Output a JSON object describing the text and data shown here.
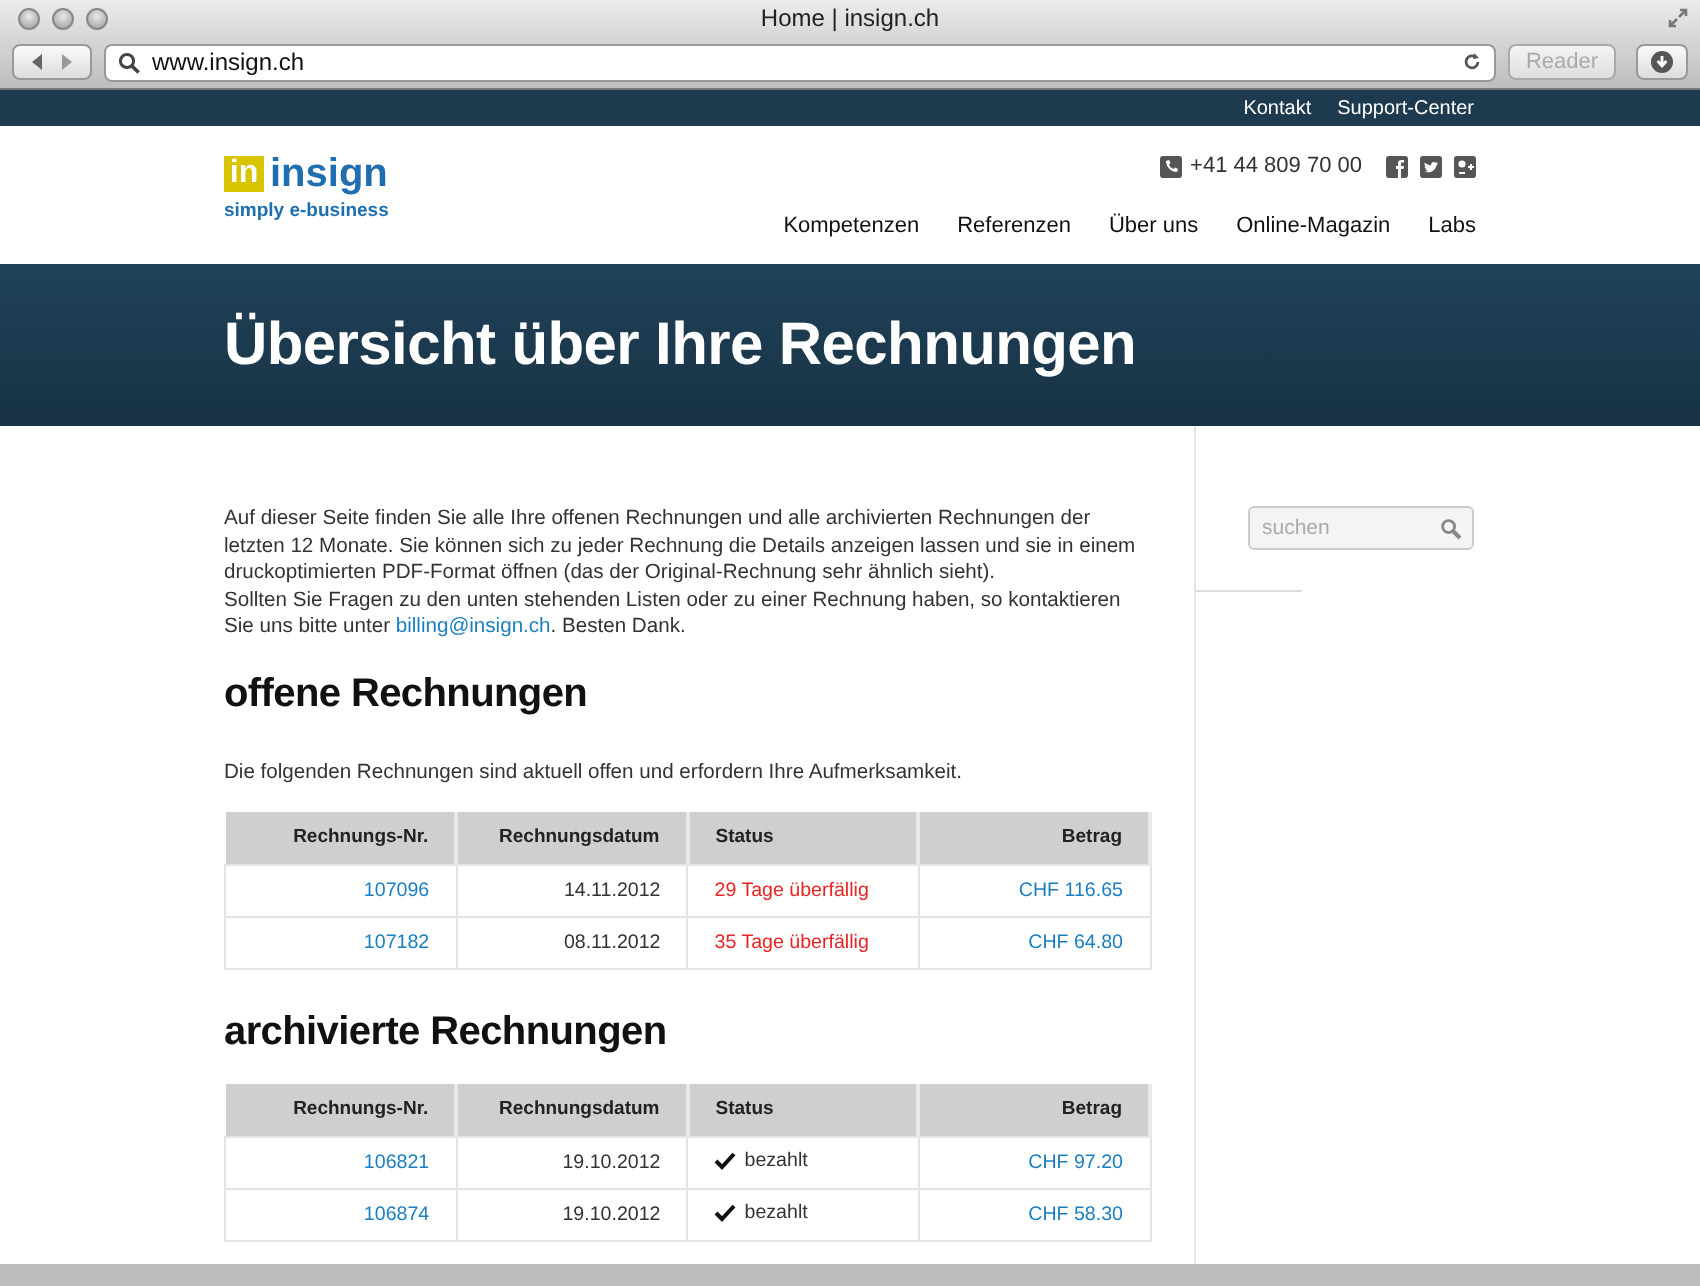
{
  "window": {
    "title": "Home | insign.ch"
  },
  "toolbar": {
    "url": "www.insign.ch",
    "reader": "Reader"
  },
  "top_links": [
    "Kontakt",
    "Support-Center"
  ],
  "logo": {
    "mark": "in",
    "name": "insign",
    "tagline": "simply e-business"
  },
  "phone": "+41 44 809 70 00",
  "nav": [
    "Kompetenzen",
    "Referenzen",
    "Über uns",
    "Online-Magazin",
    "Labs"
  ],
  "banner_title": "Übersicht über Ihre Rechnungen",
  "intro": {
    "text": "Auf dieser Seite finden Sie alle Ihre offenen Rechnungen und alle archivierten Rechnungen der letzten 12 Monate. Sie können sich zu jeder Rechnung die Details anzeigen lassen und sie in einem druckoptimierten PDF-Format öffnen (das der Original-Rechnung sehr ähnlich sieht).",
    "before_link": "Sollten Sie Fragen zu den unten stehenden Listen oder zu einer Rechnung haben, so kontaktieren Sie uns bitte unter",
    "link": "billing@insign.ch",
    "after_link": ". Besten Dank."
  },
  "search": {
    "placeholder": "suchen"
  },
  "sections": [
    {
      "heading": "offene Rechnungen",
      "note": "Die folgenden Rechnungen sind aktuell offen und erfordern Ihre Aufmerksamkeit.",
      "table": {
        "columns": [
          "Rechnungs-Nr.",
          "Rechnungsdatum",
          "Status",
          "Betrag"
        ],
        "rows": [
          {
            "number": "107096",
            "date": "14.11.2012",
            "status": "29 Tage überfällig",
            "kind": "overdue",
            "amount": "CHF 116.65"
          },
          {
            "number": "107182",
            "date": "08.11.2012",
            "status": "35 Tage überfällig",
            "kind": "overdue",
            "amount": "CHF 64.80"
          }
        ]
      }
    },
    {
      "heading": "archivierte Rechnungen",
      "table": {
        "columns": [
          "Rechnungs-Nr.",
          "Rechnungsdatum",
          "Status",
          "Betrag"
        ],
        "rows": [
          {
            "number": "106821",
            "date": "19.10.2012",
            "status": "bezahlt",
            "kind": "paid",
            "amount": "CHF 97.20"
          },
          {
            "number": "106874",
            "date": "19.10.2012",
            "status": "bezahlt",
            "kind": "paid",
            "amount": "CHF 58.30"
          }
        ]
      }
    }
  ]
}
